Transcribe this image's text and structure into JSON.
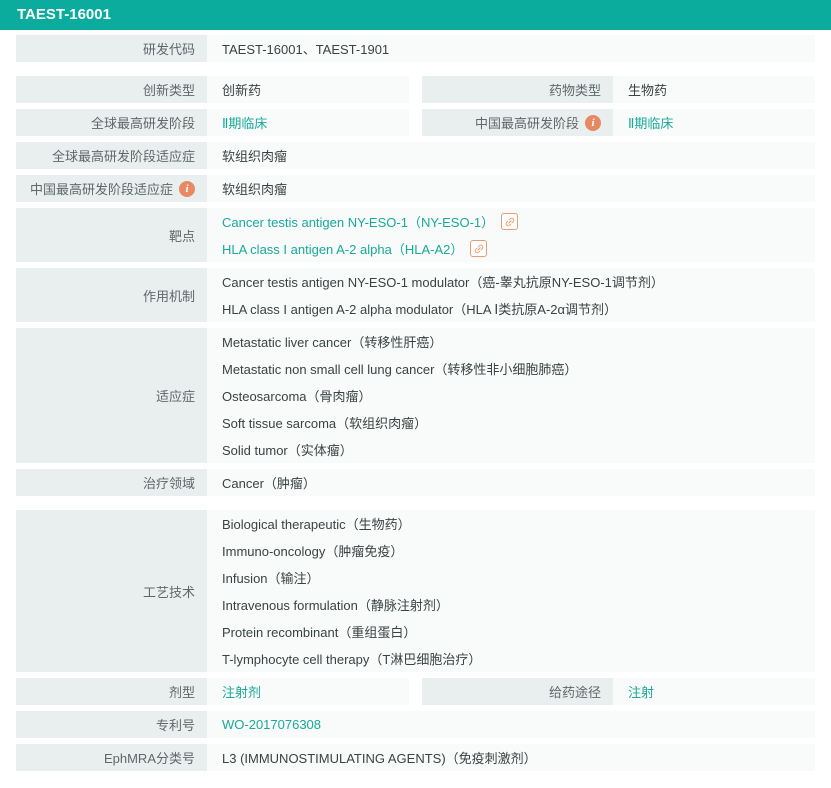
{
  "header": {
    "title": "TAEST-16001"
  },
  "colors": {
    "accent": "#19a99a",
    "header_bg": "#0bab9e",
    "label_bg": "#e9efef",
    "value_bg": "#f8fbfa",
    "info_icon": "#e78a63",
    "link_icon": "#e89d77"
  },
  "icons": {
    "info_glyph": "i"
  },
  "rows": {
    "dev_code": {
      "label": "研发代码",
      "value": "TAEST-16001、TAEST-1901"
    },
    "innovation_type": {
      "label": "创新类型",
      "value": "创新药"
    },
    "drug_type": {
      "label": "药物类型",
      "value": "生物药"
    },
    "global_stage": {
      "label": "全球最高研发阶段",
      "value": "Ⅱ期临床"
    },
    "china_stage": {
      "label": "中国最高研发阶段",
      "value": "Ⅱ期临床"
    },
    "global_stage_indication": {
      "label": "全球最高研发阶段适应症",
      "value": "软组织肉瘤"
    },
    "china_stage_indication": {
      "label": "中国最高研发阶段适应症",
      "value": "软组织肉瘤"
    },
    "target": {
      "label": "靶点",
      "items": [
        "Cancer testis antigen NY-ESO-1（NY-ESO-1）",
        "HLA class I antigen A-2 alpha（HLA-A2）"
      ]
    },
    "mechanism": {
      "label": "作用机制",
      "items": [
        "Cancer testis antigen NY-ESO-1 modulator（癌-睾丸抗原NY-ESO-1调节剂）",
        "HLA class I antigen A-2 alpha modulator（HLA Ⅰ类抗原A-2α调节剂）"
      ]
    },
    "indications": {
      "label": "适应症",
      "items": [
        "Metastatic liver cancer（转移性肝癌）",
        "Metastatic non small cell lung cancer（转移性非小细胞肺癌）",
        "Osteosarcoma（骨肉瘤）",
        "Soft tissue sarcoma（软组织肉瘤）",
        "Solid tumor（实体瘤）"
      ]
    },
    "therapy_area": {
      "label": "治疗领域",
      "value": "Cancer（肿瘤）"
    },
    "technology": {
      "label": "工艺技术",
      "items": [
        "Biological therapeutic（生物药）",
        "Immuno-oncology（肿瘤免疫）",
        "Infusion（输注）",
        "Intravenous formulation（静脉注射剂）",
        "Protein recombinant（重组蛋白）",
        "T-lymphocyte cell therapy（T淋巴细胞治疗）"
      ]
    },
    "dosage_form": {
      "label": "剂型",
      "value": "注射剂"
    },
    "route": {
      "label": "给药途径",
      "value": "注射"
    },
    "patent": {
      "label": "专利号",
      "value": "WO-2017076308"
    },
    "ephmra": {
      "label": "EphMRA分类号",
      "value": "L3 (IMMUNOSTIMULATING AGENTS)（免疫刺激剂）"
    }
  }
}
